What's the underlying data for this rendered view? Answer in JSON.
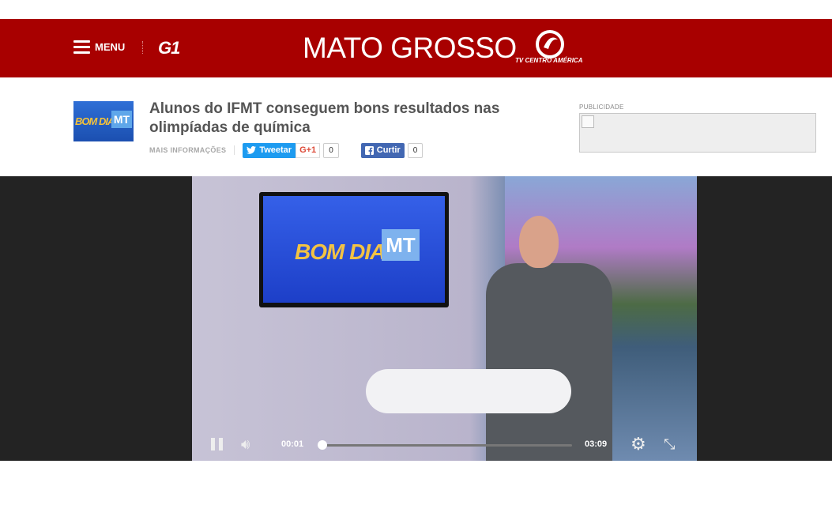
{
  "header": {
    "menu_label": "MENU",
    "brand": "G1",
    "region": "MATO GROSSO",
    "affiliate": "TV CENTRO AMÉRICA"
  },
  "article": {
    "thumb_text_1": "BOM DIA",
    "thumb_text_2": "MT",
    "title": "Alunos do IFMT conseguem bons resultados nas olimpíadas de química",
    "more_info": "MAIS INFORMAÇÕES",
    "tweet_label": "Tweetar",
    "gplus_label": "G+1",
    "gplus_count": "0",
    "fb_label": "Curtir",
    "fb_count": "0"
  },
  "ad": {
    "label": "PUBLICIDADE"
  },
  "video": {
    "screen_text_1": "BOM DIA",
    "screen_text_2": "MT",
    "current_time": "00:01",
    "duration": "03:09",
    "progress": 0.005,
    "colors": {
      "header": "#a80000",
      "twitter": "#1d9bf0",
      "facebook": "#4267b2"
    }
  },
  "icons": [
    "hamburger-icon",
    "twitter-icon",
    "facebook-icon",
    "pause-icon",
    "volume-icon",
    "settings-icon",
    "fullscreen-icon"
  ]
}
